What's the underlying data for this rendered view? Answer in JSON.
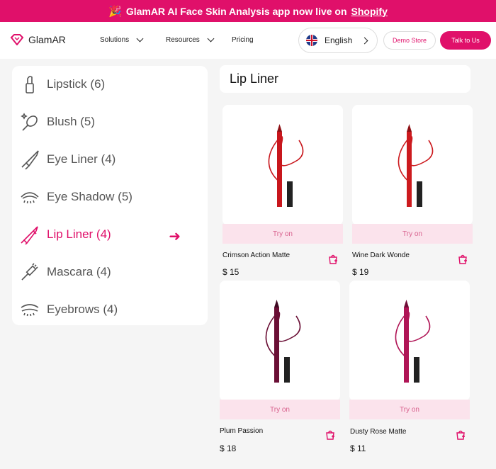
{
  "banner": {
    "text": "GlamAR AI Face Skin Analysis app now live on",
    "link": "Shopify"
  },
  "nav": {
    "logo": "GlamAR",
    "links": [
      "Solutions",
      "Resources",
      "Pricing"
    ],
    "language": "English",
    "demo": "Demo Store",
    "talk": "Talk to Us"
  },
  "sidebar": {
    "items": [
      {
        "label": "Lipstick (6)",
        "icon": "lipstick-icon"
      },
      {
        "label": "Blush (5)",
        "icon": "blush-icon"
      },
      {
        "label": "Eye Liner (4)",
        "icon": "eye-liner-icon"
      },
      {
        "label": "Eye Shadow (5)",
        "icon": "eye-shadow-icon"
      },
      {
        "label": "Lip Liner (4)",
        "icon": "lip-liner-icon",
        "active": true
      },
      {
        "label": "Mascara (4)",
        "icon": "mascara-icon"
      },
      {
        "label": "Eyebrows (4)",
        "icon": "eyebrows-icon"
      }
    ]
  },
  "main": {
    "title": "Lip Liner",
    "try_label": "Try on",
    "products": [
      {
        "name": "Crimson Action Matte",
        "price": "$ 15",
        "color": "#c8161c"
      },
      {
        "name": "Wine Dark Wonde",
        "price": "$ 19",
        "color": "#cc1a1e"
      },
      {
        "name": "Plum Passion",
        "price": "$ 18",
        "color": "#6a0f35"
      },
      {
        "name": "Dusty Rose Matte",
        "price": "$ 11",
        "color": "#b01556"
      }
    ]
  },
  "colors": {
    "accent": "#e0106a",
    "try_bg": "#fbe3ec"
  }
}
